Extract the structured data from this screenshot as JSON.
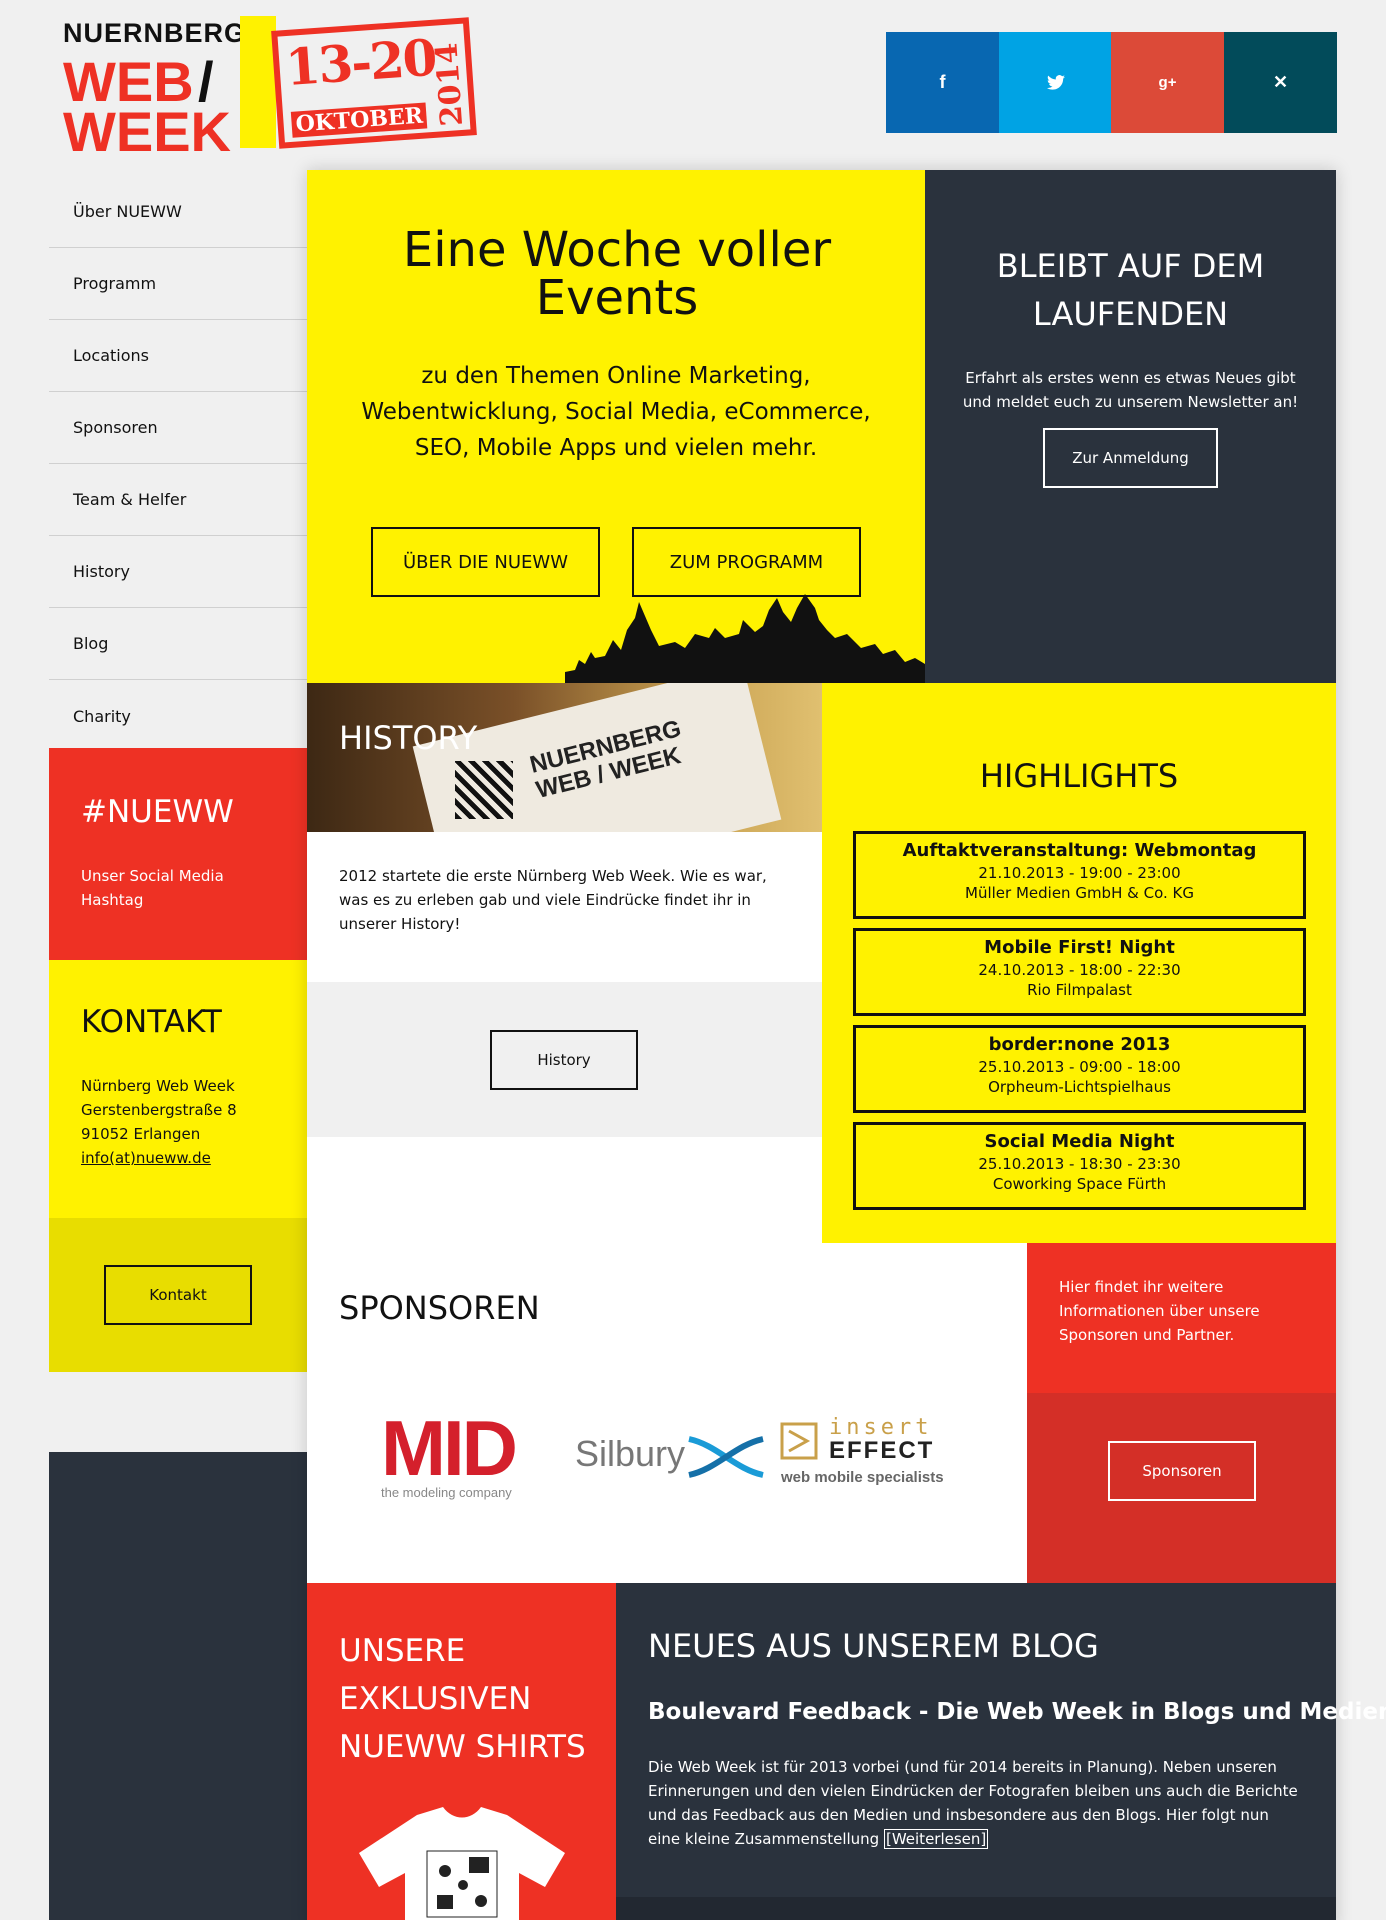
{
  "logo": {
    "line1": "NUERNBERG",
    "web": "WEB",
    "slash": "/",
    "week": "WEEK",
    "dates": "13-20",
    "month": "OKTOBER",
    "year": "2014"
  },
  "social": [
    {
      "glyph": "f",
      "name": "facebook",
      "color": "#0867b1"
    },
    {
      "glyph": "🐦",
      "name": "twitter",
      "color": "#00a3e4"
    },
    {
      "glyph": "g+",
      "name": "google-plus",
      "color": "#dc4a38"
    },
    {
      "glyph": "✕",
      "name": "xing",
      "color": "#024b5a"
    }
  ],
  "nav": [
    "Über NUEWW",
    "Programm",
    "Locations",
    "Sponsoren",
    "Team & Helfer",
    "History",
    "Blog",
    "Charity"
  ],
  "hashtag": {
    "title": "#NUEWW",
    "text": "Unser Social Media Hashtag"
  },
  "contact": {
    "title": "KONTAKT",
    "line1": "Nürnberg Web Week",
    "line2": "Gerstenbergstraße 8",
    "line3": "91052 Erlangen",
    "email": "info(at)nueww.de",
    "button": "Kontakt"
  },
  "hero": {
    "title": "Eine Woche voller Events",
    "text": "zu den Themen Online Marketing, Webentwicklung, Social Media, eCommerce, SEO, Mobile Apps und vielen mehr.",
    "btn1": "ÜBER DIE NUEWW",
    "btn2": "ZUM PROGRAMM"
  },
  "newsletter": {
    "title": "BLEIBT AUF DEM LAUFENDEN",
    "text": "Erfahrt als erstes wenn es etwas Neues gibt und meldet euch zu unserem Newsletter an!",
    "button": "Zur Anmeldung"
  },
  "history": {
    "title": "HISTORY",
    "text": "2012 startete die erste Nürnberg Web Week. Wie es war, was es zu erleben gab und viele Eindrücke findet ihr in unserer History!",
    "button": "History",
    "banner": "NUERNBERG WEB / WEEK"
  },
  "highlights": {
    "title": "HIGHLIGHTS",
    "items": [
      {
        "title": "Auftaktveranstaltung: Webmontag",
        "date": "21.10.2013 - 19:00 - 23:00",
        "place": "Müller Medien GmbH & Co. KG"
      },
      {
        "title": "Mobile First! Night",
        "date": "24.10.2013 - 18:00 - 22:30",
        "place": "Rio Filmpalast"
      },
      {
        "title": "border:none 2013",
        "date": "25.10.2013 - 09:00 - 18:00",
        "place": "Orpheum-Lichtspielhaus"
      },
      {
        "title": "Social Media Night",
        "date": "25.10.2013 - 18:30 - 23:30",
        "place": "Coworking Space Fürth"
      }
    ]
  },
  "sponsors": {
    "title": "SPONSOREN",
    "text": "Hier findet ihr weitere Informationen über unsere Sponsoren und Partner.",
    "button": "Sponsoren",
    "mid": "MID",
    "mid_sub": "the modeling company",
    "silbury": "Silbury",
    "insert": "insert",
    "effect": "EFFECT",
    "effect_sub": "web mobile specialists"
  },
  "shirts": {
    "title": "UNSERE EXKLUSIVEN NUEWW SHIRTS"
  },
  "blog": {
    "title": "NEUES AUS UNSEREM BLOG",
    "post_title": "Boulevard Feedback - Die Web Week in Blogs und Medien",
    "post_text": "Die Web Week ist für 2013 vorbei (und für 2014 bereits in Planung). Neben unseren Erinnerungen und den vielen Eindrücken der Fotografen bleiben uns auch die Berichte und das Feedback aus den Medien und insbesondere aus den Blogs. Hier folgt nun eine kleine Zusammenstellung",
    "more": "[Weiterlesen]"
  },
  "colors": {
    "yellow": "#fff200",
    "red": "#ee3124",
    "dark": "#2a323d",
    "darkred": "#d42f27"
  }
}
